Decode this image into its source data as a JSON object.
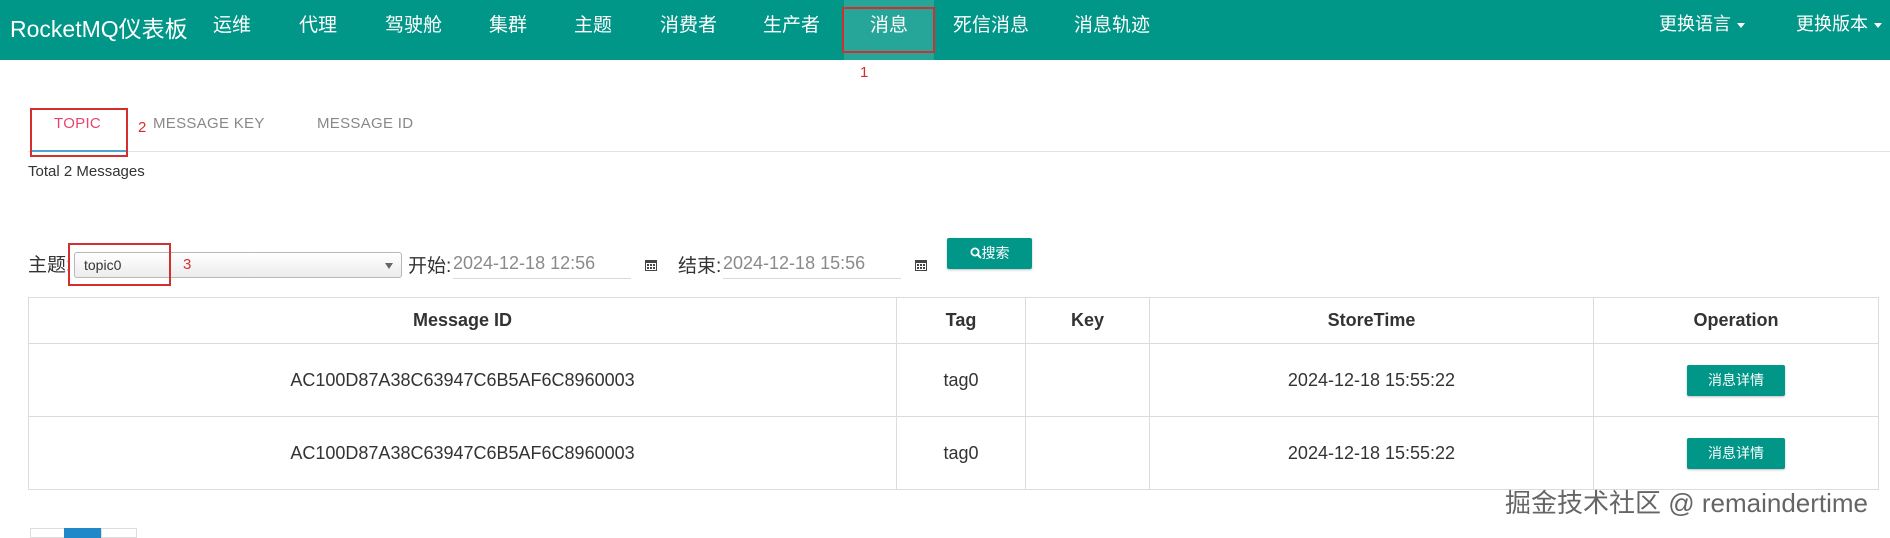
{
  "navbar": {
    "brand": "RocketMQ仪表板",
    "items": [
      "运维",
      "代理",
      "驾驶舱",
      "集群",
      "主题",
      "消费者",
      "生产者",
      "消息",
      "死信消息",
      "消息轨迹"
    ],
    "active_index": 7,
    "language": "更换语言",
    "version": "更换版本"
  },
  "annotations": [
    "1",
    "2",
    "3"
  ],
  "tabs": [
    "TOPIC",
    "MESSAGE KEY",
    "MESSAGE ID"
  ],
  "summary": "Total 2 Messages",
  "filters": {
    "topic_label": "主题:",
    "topic_value": "topic0",
    "start_label": "开始:",
    "start_value": "2024-12-18 12:56",
    "end_label": "结束:",
    "end_value": "2024-12-18 15:56",
    "search_button": "搜索"
  },
  "table": {
    "headers": [
      "Message ID",
      "Tag",
      "Key",
      "StoreTime",
      "Operation"
    ],
    "rows": [
      {
        "message_id": "AC100D87A38C63947C6B5AF6C8960003",
        "tag": "tag0",
        "key": "",
        "store_time": "2024-12-18 15:55:22",
        "operation": "消息详情"
      },
      {
        "message_id": "AC100D87A38C63947C6B5AF6C8960003",
        "tag": "tag0",
        "key": "",
        "store_time": "2024-12-18 15:55:22",
        "operation": "消息详情"
      }
    ]
  },
  "watermark": "掘金技术社区 @ remaindertime",
  "colors": {
    "primary": "#009688",
    "active_tab": "#e5466f",
    "annotation": "#d32f2f"
  }
}
